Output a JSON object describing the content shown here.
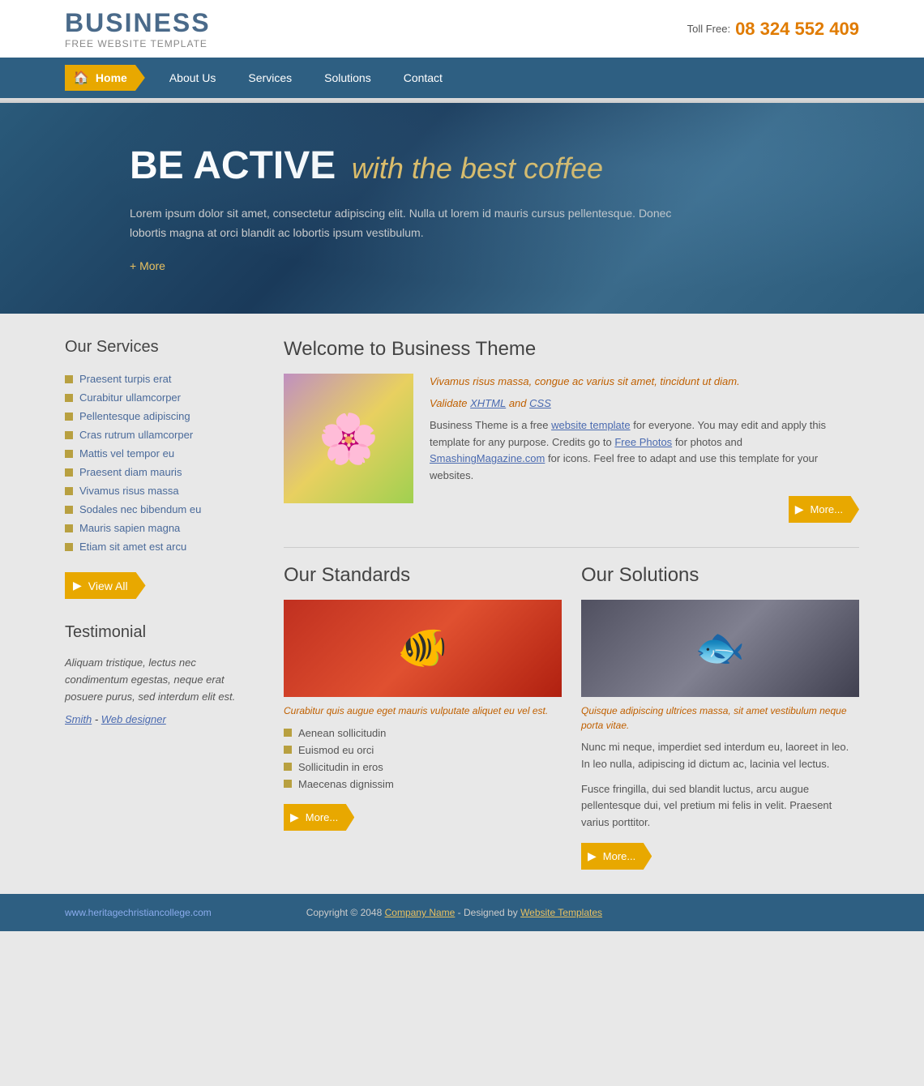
{
  "header": {
    "logo": "BUSINESS",
    "sub": "FREE WEBSITE TEMPLATE",
    "toll_free_label": "Toll Free:",
    "phone": "08 324 552 409"
  },
  "nav": {
    "home": "Home",
    "about": "About Us",
    "services": "Services",
    "solutions": "Solutions",
    "contact": "Contact"
  },
  "hero": {
    "title_main": "BE ACTIVE",
    "title_sub": "with the best coffee",
    "desc": "Lorem ipsum dolor sit amet, consectetur adipiscing elit. Nulla ut lorem id mauris cursus pellentesque. Donec lobortis magna at orci blandit ac lobortis ipsum vestibulum.",
    "more": "+ More"
  },
  "sidebar": {
    "services_title": "Our Services",
    "services": [
      "Praesent turpis erat",
      "Curabitur ullamcorper",
      "Pellentesque adipiscing",
      "Cras rutrum ullamcorper",
      "Mattis vel tempor eu",
      "Praesent diam mauris",
      "Vivamus risus massa",
      "Sodales nec bibendum eu",
      "Mauris sapien magna",
      "Etiam sit amet est arcu"
    ],
    "view_all": "View All",
    "testimonial_title": "Testimonial",
    "testimonial_text": "Aliquam tristique, lectus nec condimentum egestas, neque erat posuere purus, sed interdum elit est.",
    "author_name": "Smith",
    "author_title": "Web designer"
  },
  "welcome": {
    "title": "Welcome to Business Theme",
    "italic1": "Vivamus risus massa, congue ac varius sit amet, tincidunt ut diam.",
    "italic2": "Validate",
    "italic3": "XHTML",
    "italic4": "and",
    "italic5": "CSS",
    "body1": "Business Theme is a free",
    "link1": "website template",
    "body2": "for everyone. You may edit and apply this template for any purpose. Credits go to",
    "link2": "Free Photos",
    "body3": "for photos and",
    "link3": "SmashingMagazine.com",
    "body4": "for icons. Feel free to adapt and use this template for your websites.",
    "more_btn": "More..."
  },
  "standards": {
    "title": "Our Standards",
    "caption": "Curabitur quis augue eget mauris vulputate aliquet eu vel est.",
    "items": [
      "Aenean sollicitudin",
      "Euismod eu orci",
      "Sollicitudin in eros",
      "Maecenas dignissim"
    ],
    "more_btn": "More..."
  },
  "solutions": {
    "title": "Our Solutions",
    "caption": "Quisque adipiscing ultrices massa, sit amet vestibulum neque porta vitae.",
    "body1": "Nunc mi neque, imperdiet sed interdum eu, laoreet in leo. In leo nulla, adipiscing id dictum ac, lacinia vel lectus.",
    "body2": "Fusce fringilla, dui sed blandit luctus, arcu augue pellentesque dui, vel pretium mi felis in velit. Praesent varius porttitor.",
    "more_btn": "More..."
  },
  "footer": {
    "url": "www.heritagechristiancollege.com",
    "copy": "Copyright © 2048",
    "company_link": "Company Name",
    "designed": "- Designed by",
    "templates_link": "Website Templates"
  }
}
